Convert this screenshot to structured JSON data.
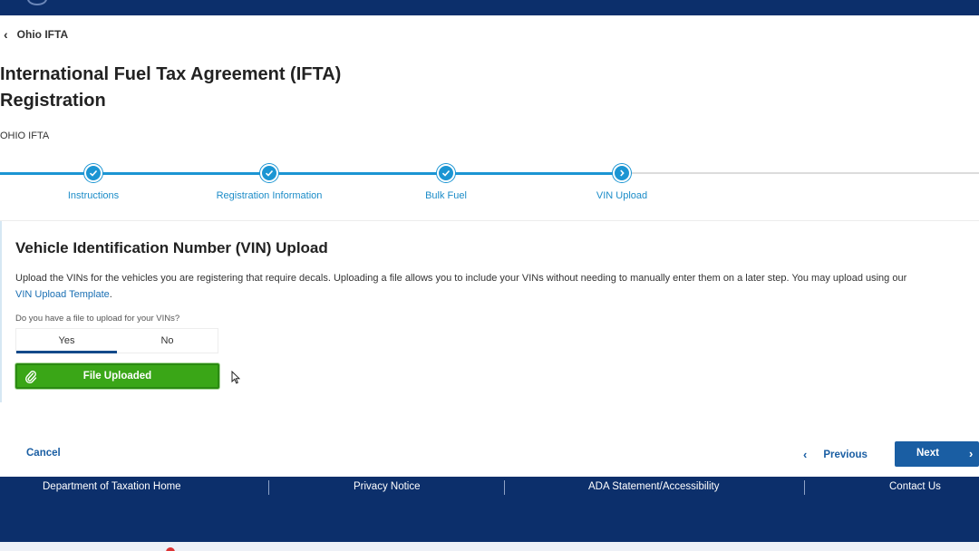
{
  "header": {
    "back_label": "Ohio IFTA"
  },
  "page": {
    "title_line1": "International Fuel Tax Agreement (IFTA)",
    "title_line2": "Registration",
    "subtitle": "OHIO IFTA"
  },
  "stepper": {
    "steps": [
      {
        "label": "Instructions",
        "state": "complete",
        "icon": "check-icon"
      },
      {
        "label": "Registration Information",
        "state": "complete",
        "icon": "check-icon"
      },
      {
        "label": "Bulk Fuel",
        "state": "complete",
        "icon": "check-icon"
      },
      {
        "label": "VIN Upload",
        "state": "current",
        "icon": "chevron-right-icon"
      }
    ],
    "accent_color": "#1b95d3"
  },
  "section": {
    "title": "Vehicle Identification Number (VIN) Upload",
    "description": "Upload the VINs for the vehicles you are registering that require decals. Uploading a file allows you to include your VINs without needing to manually enter them on a later step. You may upload using our",
    "template_link": "VIN Upload Template",
    "template_link_suffix": ".",
    "question": "Do you have a file to upload for your VINs?",
    "options": [
      "Yes",
      "No"
    ],
    "selected_option": "Yes",
    "upload_button_label": "File Uploaded",
    "upload_button_color": "#3aa617"
  },
  "actions": {
    "cancel_label": "Cancel",
    "previous_label": "Previous",
    "next_label": "Next"
  },
  "footer": {
    "links": [
      "Department of Taxation Home",
      "Privacy Notice",
      "ADA Statement/Accessibility",
      "Contact Us"
    ],
    "background_color": "#0c2f6b"
  }
}
